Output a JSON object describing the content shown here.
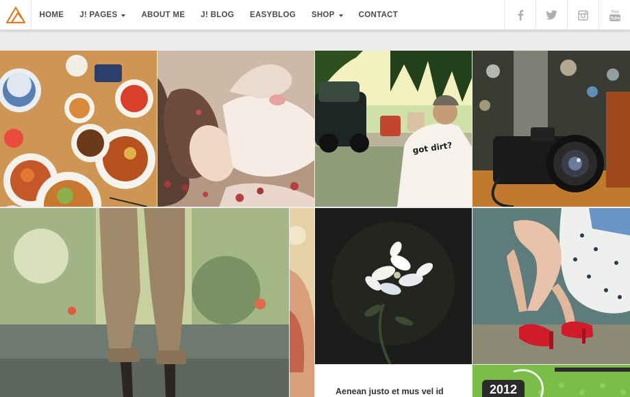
{
  "header": {
    "logo_icon": "triangle-logo-icon",
    "nav": [
      {
        "label": "HOME",
        "dropdown": false
      },
      {
        "label": "J! PAGES",
        "dropdown": true
      },
      {
        "label": "ABOUT ME",
        "dropdown": false
      },
      {
        "label": "J! BLOG",
        "dropdown": false
      },
      {
        "label": "EASYBLOG",
        "dropdown": false
      },
      {
        "label": "SHOP",
        "dropdown": true
      },
      {
        "label": "CONTACT",
        "dropdown": false
      }
    ],
    "social_icons": [
      "facebook-icon",
      "twitter-icon",
      "instagram-icon",
      "youtube-icon"
    ],
    "youtube_text": "You Tube"
  },
  "grid": {
    "street_shirt_text": "got dirt?",
    "post_title": "Aenean justo et mus vel id",
    "year": "2012"
  },
  "colors": {
    "accent_logo": "#e07a1f",
    "nav_text": "#4a4a4a",
    "icon_gray": "#b0b0b0",
    "heels_red": "#d11a2a",
    "year_green": "#7cbd4a"
  }
}
